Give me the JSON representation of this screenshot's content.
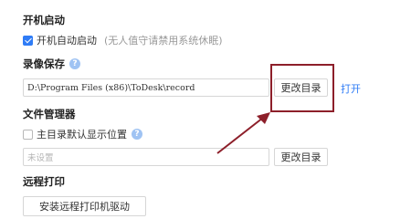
{
  "startup": {
    "heading": "开机启动",
    "auto_start_label": "开机自动启动",
    "auto_start_checked": true,
    "auto_start_hint": "(无人值守请禁用系统休眠)"
  },
  "recording": {
    "heading": "录像保存",
    "path_value": "D:\\Program Files (x86)\\ToDesk\\record",
    "change_dir_label": "更改目录",
    "open_label": "打开"
  },
  "file_manager": {
    "heading": "文件管理器",
    "default_location_label": "主目录默认显示位置",
    "default_location_checked": false,
    "path_placeholder": "未设置",
    "change_dir_label": "更改目录"
  },
  "remote_print": {
    "heading": "远程打印",
    "install_driver_label": "安装远程打印机驱动"
  },
  "annotation": {
    "color": "#8d1f2a"
  },
  "colors": {
    "accent": "#2f7cf6",
    "help_icon": "#9fc3f3"
  },
  "icons": {
    "help": "question-circle-icon",
    "check": "checkmark-icon"
  }
}
